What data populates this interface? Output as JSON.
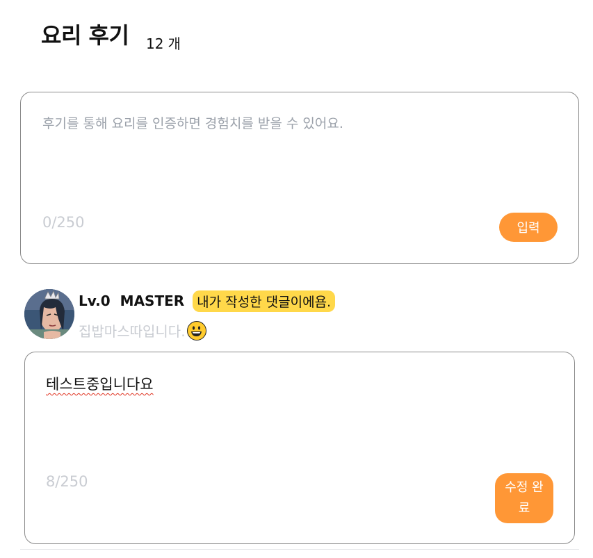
{
  "header": {
    "title": "요리 후기",
    "count": "12",
    "count_unit": "개"
  },
  "new_review": {
    "placeholder": "후기를 통해 요리를 인증하면 경험치를 받을 수 있어요.",
    "counter": "0/250",
    "submit_label": "입력"
  },
  "review": {
    "level": "Lv.0",
    "nickname": "MASTER",
    "mine_badge": "내가 작성한 댓글이에욤.",
    "intro": "집밥마스따입니다.",
    "emoji_icon": "grinning-face-emoji",
    "edit_text": "테스트중입니다요",
    "counter": "8/250",
    "save_label": "수정 완료"
  },
  "colors": {
    "accent": "#ff9736",
    "badge": "#ffd84a",
    "muted": "#c9ccd2"
  }
}
